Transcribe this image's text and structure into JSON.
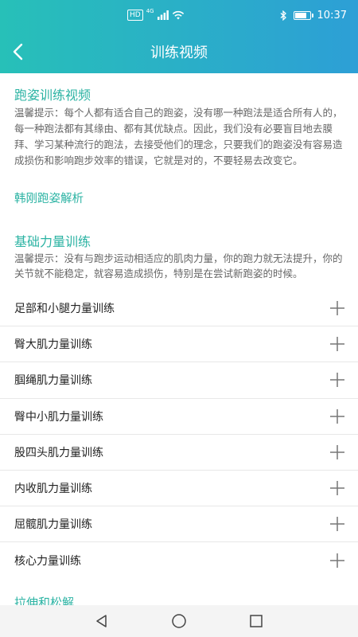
{
  "status_bar": {
    "hd": "HD",
    "network": "4G",
    "time": "10:37"
  },
  "header": {
    "title": "训练视频"
  },
  "running_posture": {
    "title": "跑姿训练视频",
    "tip": "温馨提示：每个人都有适合自己的跑姿，没有哪一种跑法是适合所有人的，每一种跑法都有其缘由、都有其优缺点。因此，我们没有必要盲目地去膜拜、学习某种流行的跑法，去接受他们的理念，只要我们的跑姿没有容易造成损伤和影响跑步效率的错误，它就是对的，不要轻易去改变它。",
    "link": "韩刚跑姿解析"
  },
  "strength": {
    "title": "基础力量训练",
    "tip": "温馨提示：没有与跑步运动相适应的肌肉力量，你的跑力就无法提升，你的关节就不能稳定，就容易造成损伤，特别是在尝试新跑姿的时候。",
    "items": [
      {
        "label": "足部和小腿力量训练"
      },
      {
        "label": "臀大肌力量训练"
      },
      {
        "label": "腘绳肌力量训练"
      },
      {
        "label": "臀中小肌力量训练"
      },
      {
        "label": "股四头肌力量训练"
      },
      {
        "label": "内收肌力量训练"
      },
      {
        "label": "屈髋肌力量训练"
      },
      {
        "label": "核心力量训练"
      }
    ]
  },
  "stretch": {
    "title": "拉伸和松解"
  },
  "colors": {
    "accent": "#2bb3a3",
    "header_start": "#27c0b8",
    "header_end": "#2d9fd6"
  }
}
